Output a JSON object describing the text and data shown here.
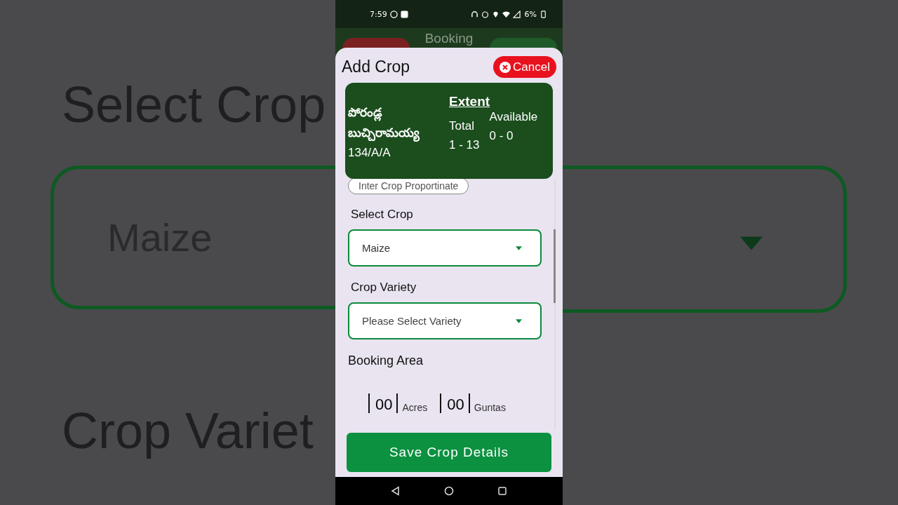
{
  "backdrop": {
    "texts": [
      "Select Crop",
      "Maize",
      "Crop Variet"
    ]
  },
  "status_bar": {
    "time": "7:59",
    "battery": "6%"
  },
  "page_title": "Booking",
  "dialog": {
    "title": "Add Crop",
    "cancel": "Cancel",
    "farmer": {
      "name": "పోరండ్ల బుచ్చిరామయ్య",
      "survey": "134/A/A",
      "extent_title": "Extent",
      "total_label": "Total",
      "total": "1 - 13",
      "available_label": "Available",
      "available": "0 - 0"
    },
    "chip": "Inter Crop Proportinate",
    "fields": [
      {
        "label": "Select Crop",
        "value": "Maize"
      },
      {
        "label": "Crop Variety",
        "placeholder": "Please Select Variety"
      }
    ],
    "booking_area": {
      "label": "Booking Area",
      "parts": [
        {
          "value": "00",
          "unit": "Acres"
        },
        {
          "value": "00",
          "unit": "Guntas"
        }
      ]
    },
    "save": "Save Crop Details"
  }
}
